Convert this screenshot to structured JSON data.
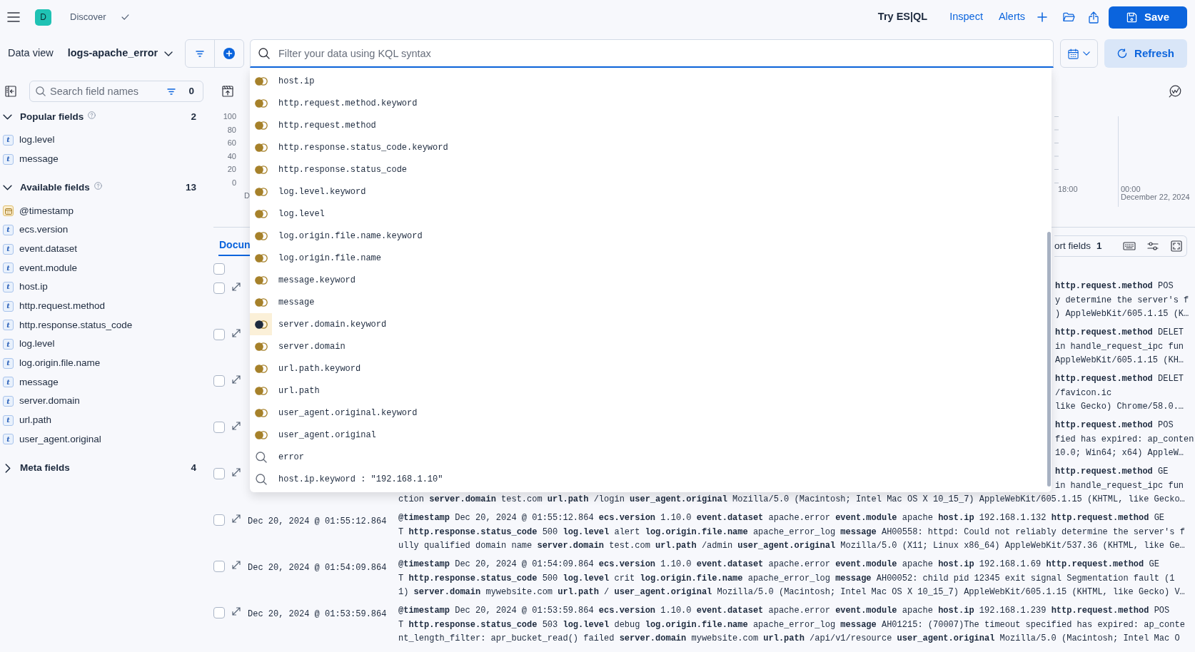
{
  "top_bar": {
    "avatar": "D",
    "breadcrumb": "Discover",
    "actions": [
      {
        "label": "Try ES|QL",
        "kind": "plain"
      },
      {
        "label": "Inspect",
        "kind": "link"
      },
      {
        "label": "Alerts",
        "kind": "link"
      }
    ],
    "save_button": "Save"
  },
  "query_bar": {
    "data_view_label": "Data view",
    "data_view": "logs-apache_error",
    "placeholder": "Filter your data using KQL syntax",
    "refresh_button": "Refresh"
  },
  "suggestions": [
    {
      "kind": "field",
      "text": "host.ip",
      "selected": false
    },
    {
      "kind": "field",
      "text": "http.request.method.keyword",
      "selected": false
    },
    {
      "kind": "field",
      "text": "http.request.method",
      "selected": false
    },
    {
      "kind": "field",
      "text": "http.response.status_code.keyword",
      "selected": false
    },
    {
      "kind": "field",
      "text": "http.response.status_code",
      "selected": false
    },
    {
      "kind": "field",
      "text": "log.level.keyword",
      "selected": false
    },
    {
      "kind": "field",
      "text": "log.level",
      "selected": false
    },
    {
      "kind": "field",
      "text": "log.origin.file.name.keyword",
      "selected": false
    },
    {
      "kind": "field",
      "text": "log.origin.file.name",
      "selected": false
    },
    {
      "kind": "field",
      "text": "message.keyword",
      "selected": false
    },
    {
      "kind": "field",
      "text": "message",
      "selected": false
    },
    {
      "kind": "field",
      "text": "server.domain.keyword",
      "selected": true
    },
    {
      "kind": "field",
      "text": "server.domain",
      "selected": false
    },
    {
      "kind": "field",
      "text": "url.path.keyword",
      "selected": false
    },
    {
      "kind": "field",
      "text": "url.path",
      "selected": false
    },
    {
      "kind": "field",
      "text": "user_agent.original.keyword",
      "selected": false
    },
    {
      "kind": "field",
      "text": "user_agent.original",
      "selected": false
    },
    {
      "kind": "query",
      "text": "error",
      "selected": false
    },
    {
      "kind": "query",
      "text": "host.ip.keyword : \"192.168.1.10\"",
      "selected": false
    }
  ],
  "sidebar": {
    "search_placeholder": "Search field names",
    "filter_count": "0",
    "sections": [
      {
        "title": "Popular fields",
        "help": true,
        "count": "2",
        "expanded": true,
        "fields": [
          {
            "name": "log.level",
            "kind": "text",
            "token": "t"
          },
          {
            "name": "message",
            "kind": "text",
            "token": "t"
          }
        ]
      },
      {
        "title": "Available fields",
        "help": true,
        "count": "13",
        "expanded": true,
        "fields": [
          {
            "name": "@timestamp",
            "kind": "date"
          },
          {
            "name": "ecs.version",
            "kind": "text",
            "token": "t"
          },
          {
            "name": "event.dataset",
            "kind": "text",
            "token": "t"
          },
          {
            "name": "event.module",
            "kind": "text",
            "token": "t"
          },
          {
            "name": "host.ip",
            "kind": "text",
            "token": "t"
          },
          {
            "name": "http.request.method",
            "kind": "text",
            "token": "t"
          },
          {
            "name": "http.response.status_code",
            "kind": "text",
            "token": "t"
          },
          {
            "name": "log.level",
            "kind": "text",
            "token": "t"
          },
          {
            "name": "log.origin.file.name",
            "kind": "text",
            "token": "t"
          },
          {
            "name": "message",
            "kind": "text",
            "token": "t"
          },
          {
            "name": "server.domain",
            "kind": "text",
            "token": "t"
          },
          {
            "name": "url.path",
            "kind": "text",
            "token": "t"
          },
          {
            "name": "user_agent.original",
            "kind": "text",
            "token": "t"
          }
        ]
      },
      {
        "title": "Meta fields",
        "help": false,
        "count": "4",
        "expanded": false
      }
    ]
  },
  "histogram": {
    "y_ticks": [
      "100",
      "80",
      "60",
      "40",
      "20",
      "0"
    ],
    "x_labels": [
      "D",
      "18:00",
      "00:00"
    ],
    "date_label": "December 22, 2024"
  },
  "documents": {
    "tabs": [
      {
        "label": "Docun",
        "selected": true
      }
    ],
    "sort_label": "ort fields",
    "sort_count": "1",
    "header_checked": false,
    "rows": [
      {
        "checked": false,
        "lines": [
          {
            "kind": "fragment",
            "text": "**http.request.method** POS"
          },
          {
            "kind": "fragment",
            "text": "y determine the server's f"
          },
          {
            "kind": "fragment",
            "text": ") AppleWebKit/605.1.15 (K…"
          }
        ]
      },
      {
        "checked": false,
        "lines": [
          {
            "kind": "fragment",
            "text": "**http.request.method** DELET"
          },
          {
            "kind": "fragment",
            "text": "in handle_request_ipc fun"
          },
          {
            "kind": "fragment",
            "text": "AppleWebKit/605.1.15 (KH…"
          }
        ]
      },
      {
        "checked": false,
        "lines": [
          {
            "kind": "fragment",
            "text": "**http.request.method** DELET"
          },
          {
            "kind": "fragment",
            "text": "/favicon.ic"
          },
          {
            "kind": "fragment",
            "text": "like Gecko) Chrome/58.0.…"
          }
        ]
      },
      {
        "checked": false,
        "lines": [
          {
            "kind": "fragment",
            "text": "**http.request.method** POS"
          },
          {
            "kind": "fragment",
            "text": "fied has expired: ap_conten"
          },
          {
            "kind": "fragment",
            "text": "10.0; Win64; x64) AppleW…"
          }
        ]
      },
      {
        "checked": false,
        "lines": [
          {
            "kind": "fragment",
            "text": "**http.request.method** GE"
          },
          {
            "kind": "fragment",
            "text": "in handle_request_ipc fun"
          },
          {
            "kind": "full",
            "text": "ction **server.domain** test.com **url.path** /login **user_agent.original** Mozilla/5.0 (Macintosh; Intel Mac OS X 10_15_7) AppleWebKit/605.1.15 (KHTML, like Gecko…"
          }
        ]
      },
      {
        "checked": false,
        "timestamp": "Dec 20, 2024 @ 01:55:12.864",
        "lines": [
          {
            "kind": "full",
            "text": "**@timestamp** Dec 20, 2024 @ 01:55:12.864 **ecs.version** 1.10.0 **event.dataset** apache.error **event.module** apache **host.ip** 192.168.1.132 **http.request.method** GE"
          },
          {
            "kind": "full",
            "text": "T **http.response.status_code** 500 **log.level** alert **log.origin.file.name** apache_error_log **message** AH00558: httpd: Could not reliably determine the server's f"
          },
          {
            "kind": "full",
            "text": "ully qualified domain name **server.domain** test.com **url.path** /admin **user_agent.original** Mozilla/5.0 (X11; Linux x86_64) AppleWebKit/537.36 (KHTML, like Ge…"
          }
        ]
      },
      {
        "checked": false,
        "timestamp": "Dec 20, 2024 @ 01:54:09.864",
        "lines": [
          {
            "kind": "full",
            "text": "**@timestamp** Dec 20, 2024 @ 01:54:09.864 **ecs.version** 1.10.0 **event.dataset** apache.error **event.module** apache **host.ip** 192.168.1.69 **http.request.method** GE"
          },
          {
            "kind": "full",
            "text": "T **http.response.status_code** 500 **log.level** crit **log.origin.file.name** apache_error_log **message** AH00052: child pid 12345 exit signal Segmentation fault (1"
          },
          {
            "kind": "full",
            "text": "1) **server.domain** mywebsite.com **url.path** / **user_agent.original** Mozilla/5.0 (Macintosh; Intel Mac OS X 10_15_7) AppleWebKit/605.1.15 (KHTML, like Gecko) V…"
          }
        ]
      },
      {
        "checked": false,
        "timestamp": "Dec 20, 2024 @ 01:53:59.864",
        "lines": [
          {
            "kind": "full",
            "text": "**@timestamp** Dec 20, 2024 @ 01:53:59.864 **ecs.version** 1.10.0 **event.dataset** apache.error **event.module** apache **host.ip** 192.168.1.239 **http.request.method** POS"
          },
          {
            "kind": "full",
            "text": "T **http.response.status_code** 503 **log.level** debug **log.origin.file.name** apache_error_log **message** AH01215: (70007)The timeout specified has expired: ap_conte"
          },
          {
            "kind": "full",
            "text": "nt_length_filter: apr_bucket_read() failed **server.domain** mywebsite.com **url.path** /api/v1/resource **user_agent.original** Mozilla/5.0 (Macintosh; Intel Mac O"
          }
        ]
      }
    ]
  }
}
